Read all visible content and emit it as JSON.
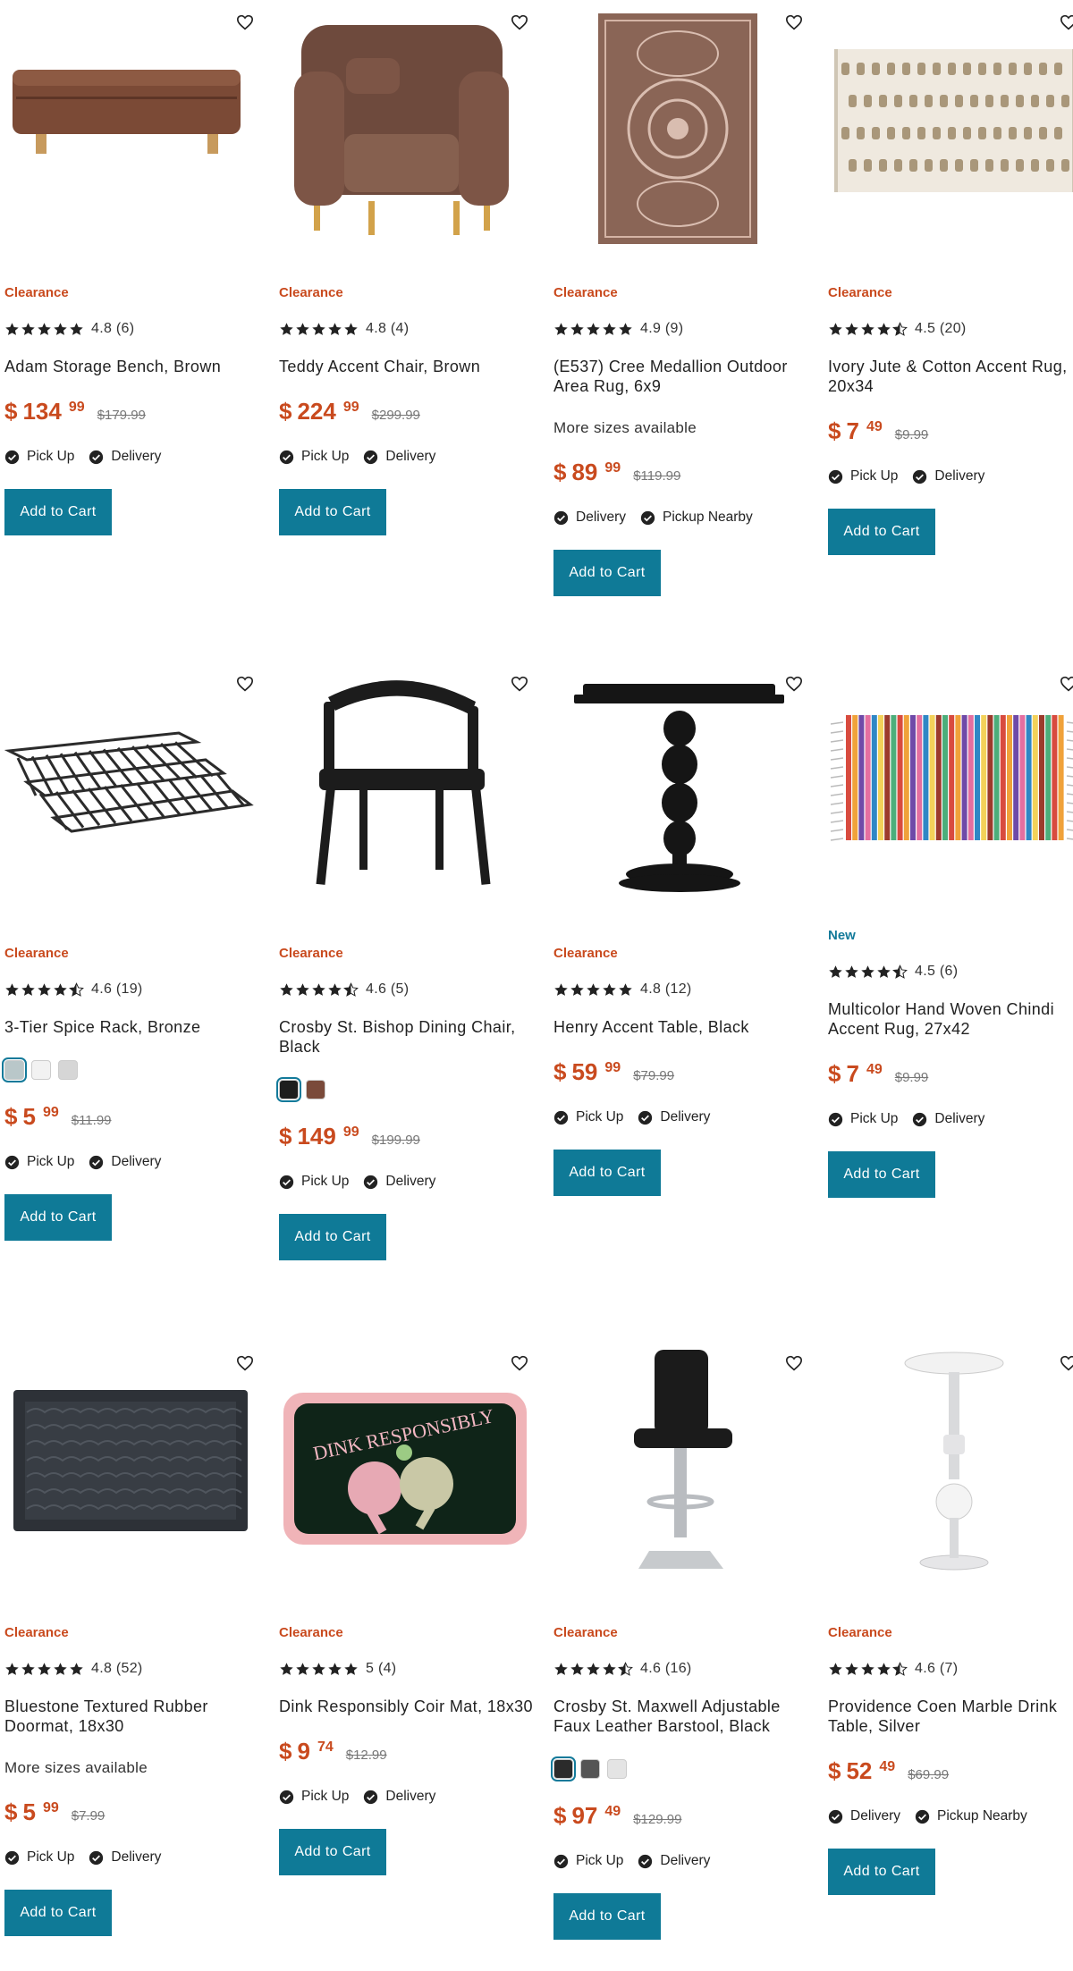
{
  "colors": {
    "accent": "#0f7a97",
    "clearance": "#c94a1e",
    "new": "#137a9a"
  },
  "products": [
    {
      "badge": "Clearance",
      "rating": "4.8 (6)",
      "stars": 5,
      "title": "Adam Storage Bench, Brown",
      "price_dollar": "$",
      "price_whole": "134",
      "price_cents": "99",
      "was": "$179.99",
      "fulfill": [
        "Pick Up",
        "Delivery"
      ],
      "cart": "Add to Cart",
      "image": "storage-bench-image"
    },
    {
      "badge": "Clearance",
      "rating": "4.8 (4)",
      "stars": 5,
      "title": "Teddy Accent Chair, Brown",
      "price_dollar": "$",
      "price_whole": "224",
      "price_cents": "99",
      "was": "$299.99",
      "fulfill": [
        "Pick Up",
        "Delivery"
      ],
      "cart": "Add to Cart",
      "image": "accent-chair-image"
    },
    {
      "badge": "Clearance",
      "rating": "4.9 (9)",
      "stars": 5,
      "title": "(E537) Cree Medallion Outdoor Area Rug, 6x9",
      "sizes": "More sizes available",
      "price_dollar": "$",
      "price_whole": "89",
      "price_cents": "99",
      "was": "$119.99",
      "fulfill": [
        "Delivery",
        "Pickup Nearby"
      ],
      "cart": "Add to Cart",
      "image": "medallion-rug-image"
    },
    {
      "badge": "Clearance",
      "rating": "4.5 (20)",
      "stars": 4.5,
      "title": "Ivory Jute & Cotton Accent Rug, 20x34",
      "price_dollar": "$",
      "price_whole": "7",
      "price_cents": "49",
      "was": "$9.99",
      "fulfill": [
        "Pick Up",
        "Delivery"
      ],
      "cart": "Add to Cart",
      "image": "jute-rug-image"
    },
    {
      "badge": "Clearance",
      "rating": "4.6 (19)",
      "stars": 4.5,
      "title": "3-Tier Spice Rack, Bronze",
      "swatches": [
        "#b9c7c9",
        "#f2f2f2",
        "#d6d6d6"
      ],
      "price_dollar": "$",
      "price_whole": "5",
      "price_cents": "99",
      "was": "$11.99",
      "fulfill": [
        "Pick Up",
        "Delivery"
      ],
      "cart": "Add to Cart",
      "image": "spice-rack-image"
    },
    {
      "badge": "Clearance",
      "rating": "4.6 (5)",
      "stars": 4.5,
      "title": "Crosby St. Bishop Dining Chair, Black",
      "swatches": [
        "#1e1e1e",
        "#7a4a3a"
      ],
      "price_dollar": "$",
      "price_whole": "149",
      "price_cents": "99",
      "was": "$199.99",
      "fulfill": [
        "Pick Up",
        "Delivery"
      ],
      "cart": "Add to Cart",
      "image": "dining-chair-image"
    },
    {
      "badge": "Clearance",
      "rating": "4.8 (12)",
      "stars": 5,
      "title": "Henry Accent Table, Black",
      "price_dollar": "$",
      "price_whole": "59",
      "price_cents": "99",
      "was": "$79.99",
      "fulfill": [
        "Pick Up",
        "Delivery"
      ],
      "cart": "Add to Cart",
      "image": "accent-table-image"
    },
    {
      "badge": "New",
      "badge_type": "new",
      "rating": "4.5 (6)",
      "stars": 4.5,
      "title": "Multicolor Hand Woven Chindi Accent Rug, 27x42",
      "price_dollar": "$",
      "price_whole": "7",
      "price_cents": "49",
      "was": "$9.99",
      "fulfill": [
        "Pick Up",
        "Delivery"
      ],
      "cart": "Add to Cart",
      "image": "chindi-rug-image"
    },
    {
      "badge": "Clearance",
      "rating": "4.8 (52)",
      "stars": 5,
      "title": "Bluestone Textured Rubber Doormat, 18x30",
      "sizes": "More sizes available",
      "price_dollar": "$",
      "price_whole": "5",
      "price_cents": "99",
      "was": "$7.99",
      "fulfill": [
        "Pick Up",
        "Delivery"
      ],
      "cart": "Add to Cart",
      "image": "rubber-doormat-image"
    },
    {
      "badge": "Clearance",
      "rating": "5 (4)",
      "stars": 5,
      "title": "Dink Responsibly Coir Mat, 18x30",
      "price_dollar": "$",
      "price_whole": "9",
      "price_cents": "74",
      "was": "$12.99",
      "fulfill": [
        "Pick Up",
        "Delivery"
      ],
      "cart": "Add to Cart",
      "image": "coir-mat-image",
      "image_text": "DINK RESPONSIBLY"
    },
    {
      "badge": "Clearance",
      "rating": "4.6 (16)",
      "stars": 4.5,
      "title": "Crosby St. Maxwell Adjustable Faux Leather Barstool, Black",
      "swatches": [
        "#2b2b2b",
        "#555555",
        "#e4e4e4"
      ],
      "price_dollar": "$",
      "price_whole": "97",
      "price_cents": "49",
      "was": "$129.99",
      "fulfill": [
        "Pick Up",
        "Delivery"
      ],
      "cart": "Add to Cart",
      "image": "barstool-image"
    },
    {
      "badge": "Clearance",
      "rating": "4.6 (7)",
      "stars": 4.5,
      "title": "Providence Coen Marble Drink Table, Silver",
      "price_dollar": "$",
      "price_whole": "52",
      "price_cents": "49",
      "was": "$69.99",
      "fulfill": [
        "Delivery",
        "Pickup Nearby"
      ],
      "cart": "Add to Cart",
      "image": "drink-table-image"
    }
  ]
}
